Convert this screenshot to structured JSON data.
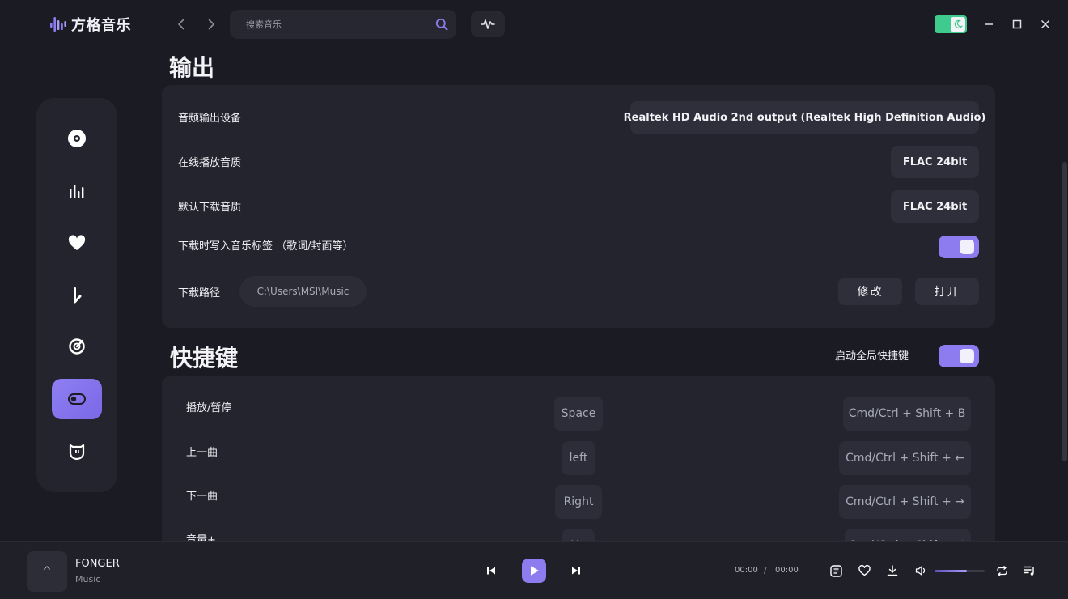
{
  "app": {
    "name": "方格音乐"
  },
  "search": {
    "placeholder": "搜索音乐"
  },
  "colors": {
    "accent": "#8c7cf0",
    "theme_toggle": "#3fcb8d",
    "background": "#1b1c23",
    "panel": "#23242d"
  },
  "sidebar": {
    "items": [
      {
        "icon": "disc-icon"
      },
      {
        "icon": "chart-bars-icon"
      },
      {
        "icon": "heart-icon"
      },
      {
        "icon": "music-note-icon"
      },
      {
        "icon": "radar-icon"
      },
      {
        "icon": "toggle-settings-icon",
        "active": true
      },
      {
        "icon": "cat-face-icon"
      }
    ]
  },
  "output": {
    "title": "输出",
    "device_label": "音频输出设备",
    "device_value": "Realtek HD Audio 2nd output (Realtek High Definition Audio)",
    "online_quality_label": "在线播放音质",
    "online_quality_value": "FLAC 24bit",
    "download_quality_label": "默认下载音质",
    "download_quality_value": "FLAC 24bit",
    "write_tags_label": "下载时写入音乐标签 （歌词/封面等）",
    "write_tags_on": true,
    "path_label": "下载路径",
    "path_value": "C:\\Users\\MSI\\Music",
    "modify_label": "修改",
    "open_label": "打开"
  },
  "shortcuts": {
    "title": "快捷键",
    "global_label": "启动全局快捷键",
    "global_on": true,
    "rows": [
      {
        "action": "播放/暂停",
        "key": "Space",
        "global": "Cmd/Ctrl + Shift + B"
      },
      {
        "action": "上一曲",
        "key": "left",
        "global": "Cmd/Ctrl + Shift + ←"
      },
      {
        "action": "下一曲",
        "key": "Right",
        "global": "Cmd/Ctrl + Shift + →"
      },
      {
        "action": "音量+",
        "key": "Up",
        "global": "Cmd/Ctrl + Shift + ↑"
      }
    ]
  },
  "player": {
    "cover_glyph": "^",
    "title": "FONGER",
    "artist": "Music",
    "current_time": "00:00",
    "separator": "/",
    "total_time": "00:00",
    "volume": 0.65
  }
}
